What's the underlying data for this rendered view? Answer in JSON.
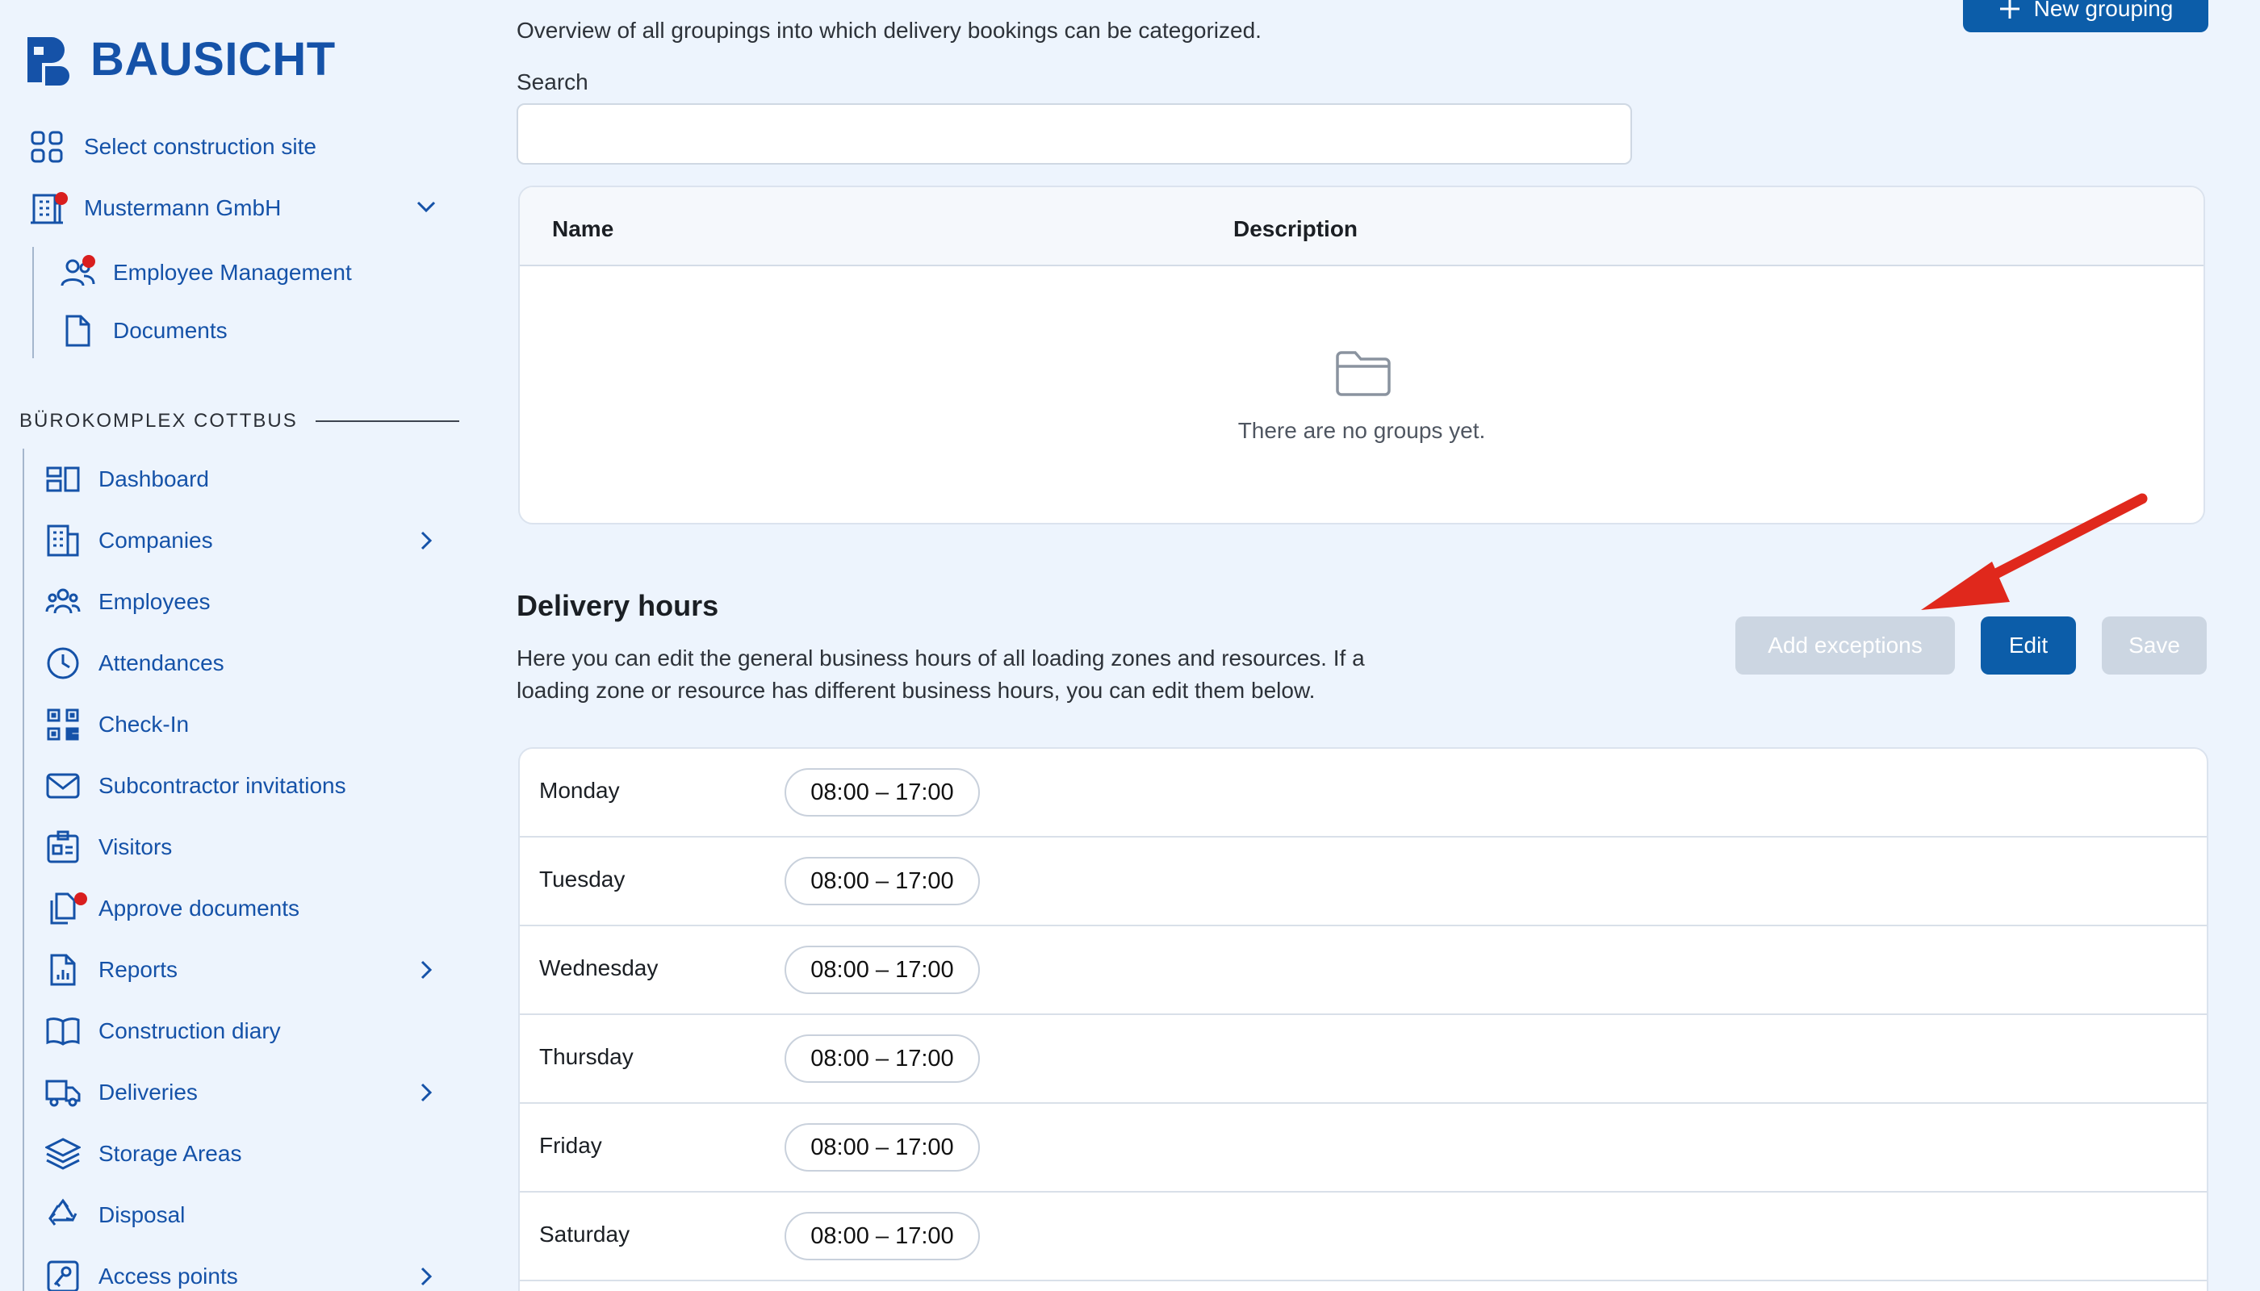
{
  "brand": {
    "name": "BAUSICHT",
    "color": "#1552a8"
  },
  "sidebar": {
    "select_site": "Select construction site",
    "company": {
      "label": "Mustermann GmbH",
      "icon": "building-icon"
    },
    "company_children": [
      {
        "label": "Employee Management",
        "icon": "users-icon"
      },
      {
        "label": "Documents",
        "icon": "document-icon"
      }
    ],
    "section_title": "BÜROKOMPLEX COTTBUS",
    "items": [
      {
        "label": "Dashboard",
        "icon": "dashboard-icon"
      },
      {
        "label": "Companies",
        "icon": "building-icon"
      },
      {
        "label": "Employees",
        "icon": "users-icon"
      },
      {
        "label": "Attendances",
        "icon": "clock-icon"
      },
      {
        "label": "Check-In",
        "icon": "qr-code-icon"
      },
      {
        "label": "Subcontractor invitations",
        "icon": "envelope-icon"
      },
      {
        "label": "Visitors",
        "icon": "id-card-icon"
      },
      {
        "label": "Approve documents",
        "icon": "documents-icon"
      },
      {
        "label": "Reports",
        "icon": "report-icon"
      },
      {
        "label": "Construction diary",
        "icon": "book-icon"
      },
      {
        "label": "Deliveries",
        "icon": "truck-icon"
      },
      {
        "label": "Storage Areas",
        "icon": "layers-icon"
      },
      {
        "label": "Disposal",
        "icon": "recycle-icon"
      },
      {
        "label": "Access points",
        "icon": "access-icon"
      }
    ]
  },
  "groupings": {
    "description": "Overview of all groupings into which delivery bookings can be categorized.",
    "new_button": "New grouping",
    "search_label": "Search",
    "search_value": "",
    "columns": [
      "Name",
      "Description"
    ],
    "empty_text": "There are no groups yet."
  },
  "delivery_hours": {
    "title": "Delivery hours",
    "description": "Here you can edit the general business hours of all loading zones and resources. If a loading zone or resource has different business hours, you can edit them below.",
    "buttons": {
      "add_exceptions": "Add exceptions",
      "edit": "Edit",
      "save": "Save"
    },
    "rows": [
      {
        "day": "Monday",
        "hours": "08:00 – 17:00"
      },
      {
        "day": "Tuesday",
        "hours": "08:00 – 17:00"
      },
      {
        "day": "Wednesday",
        "hours": "08:00 – 17:00"
      },
      {
        "day": "Thursday",
        "hours": "08:00 – 17:00"
      },
      {
        "day": "Friday",
        "hours": "08:00 – 17:00"
      },
      {
        "day": "Saturday",
        "hours": "08:00 – 17:00"
      }
    ]
  },
  "colors": {
    "primary": "#0c5da9",
    "disabled": "#ccd6e2",
    "notification": "#d91e1e",
    "annotation_arrow": "#e0281c"
  }
}
